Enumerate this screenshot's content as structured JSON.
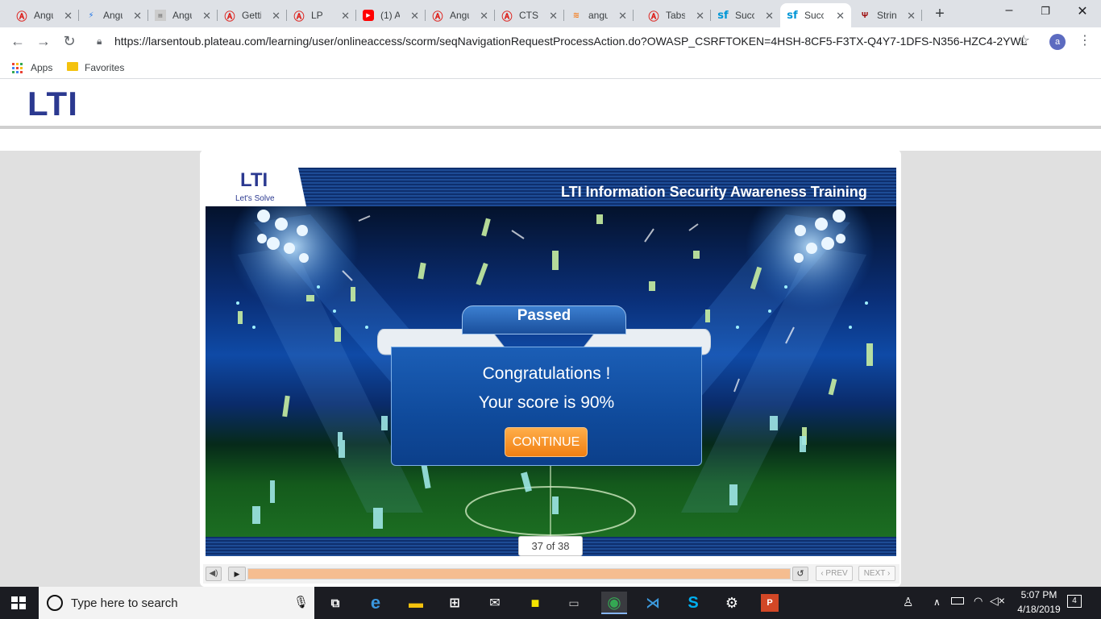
{
  "browser": {
    "tabs": [
      {
        "icon": "angular-icon",
        "title": "Angu"
      },
      {
        "icon": "bolt-icon",
        "title": "Angu"
      },
      {
        "icon": "page-icon",
        "title": "Angu"
      },
      {
        "icon": "angular-icon",
        "title": "Getti"
      },
      {
        "icon": "angular-icon",
        "title": "LP"
      },
      {
        "icon": "youtube-icon",
        "title": "(1) A"
      },
      {
        "icon": "angular-icon",
        "title": "Angu"
      },
      {
        "icon": "angular-icon",
        "title": "CTS"
      },
      {
        "icon": "stackoverflow-icon",
        "title": "angu"
      },
      {
        "icon": "angular-icon",
        "title": "Tabs"
      },
      {
        "icon": "sf-icon",
        "title": "Succ"
      },
      {
        "icon": "sf-icon",
        "title": "Succ",
        "active": true
      },
      {
        "icon": "trident-icon",
        "title": "Strin"
      }
    ],
    "new_tab": "+",
    "url": "https://larsentoub.plateau.com/learning/user/onlineaccess/scorm/seqNavigationRequestProcessAction.do?OWASP_CSRFTOKEN=4HSH-8CF5-F3TX-Q4Y7-1DFS-N356-HZC4-2YWL",
    "profile_initial": "a",
    "bookmarks": {
      "apps": "Apps",
      "favorites": "Favorites"
    }
  },
  "site": {
    "logo": "LTI"
  },
  "course": {
    "badge_logo": "LTI",
    "badge_tagline": "Let's Solve",
    "title": "LTI Information Security Awareness Training",
    "banner": "Passed",
    "congrats": "Congratulations !",
    "score_text": "Your score is 90%",
    "continue_label": "CONTINUE",
    "page_counter": "37 of 38",
    "progress": 1.0,
    "prev_label": "‹ PREV",
    "next_label": "NEXT ›"
  },
  "taskbar": {
    "search_placeholder": "Type here to search",
    "time": "5:07 PM",
    "date": "4/18/2019",
    "notifications": "4"
  },
  "colors": {
    "brand_blue": "#2b3990",
    "continue_orange": "#f07f12",
    "header_navy": "#0e2f6e"
  }
}
